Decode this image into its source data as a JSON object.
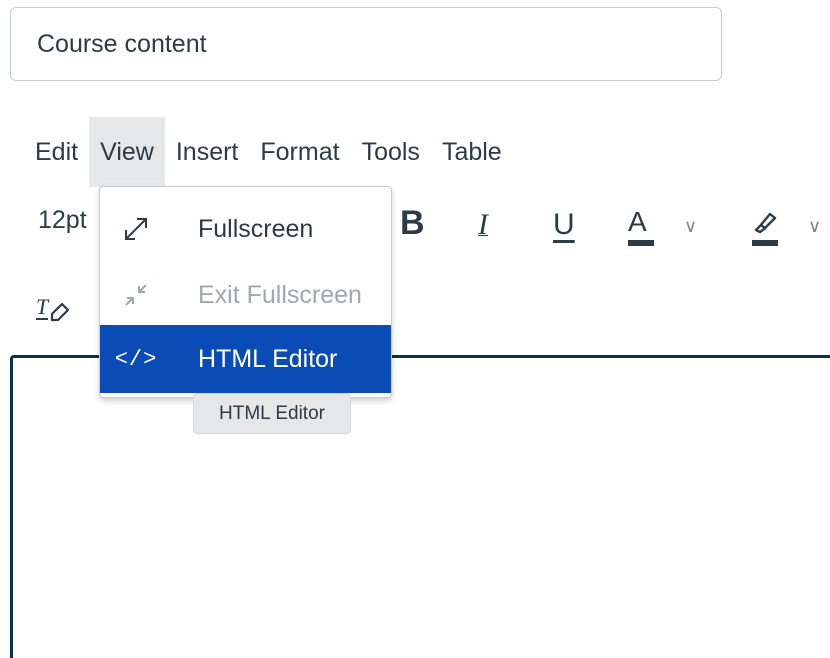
{
  "title_field": {
    "value": "Course content"
  },
  "menubar": {
    "items": [
      {
        "label": "Edit"
      },
      {
        "label": "View"
      },
      {
        "label": "Insert"
      },
      {
        "label": "Format"
      },
      {
        "label": "Tools"
      },
      {
        "label": "Table"
      }
    ],
    "active": "View"
  },
  "toolbar": {
    "font_size": "12pt",
    "bold_glyph": "B",
    "italic_glyph": "I",
    "underline_glyph": "U",
    "font_color_glyph": "A",
    "chevron_glyph": "∨",
    "clear_format_glyph": "T"
  },
  "view_menu": {
    "items": [
      {
        "label": "Fullscreen",
        "icon": "expand-icon",
        "state": "enabled"
      },
      {
        "label": "Exit Fullscreen",
        "icon": "collapse-icon",
        "state": "disabled"
      },
      {
        "label": "HTML Editor",
        "icon": "code-icon",
        "icon_text": "</>",
        "state": "highlighted"
      }
    ]
  },
  "tooltip": {
    "text": "HTML Editor"
  },
  "colors": {
    "highlight": "#0b4bb5",
    "editor_border": "#0e2f50",
    "text": "#2d3b45",
    "disabled_text": "#a0a8ae"
  }
}
